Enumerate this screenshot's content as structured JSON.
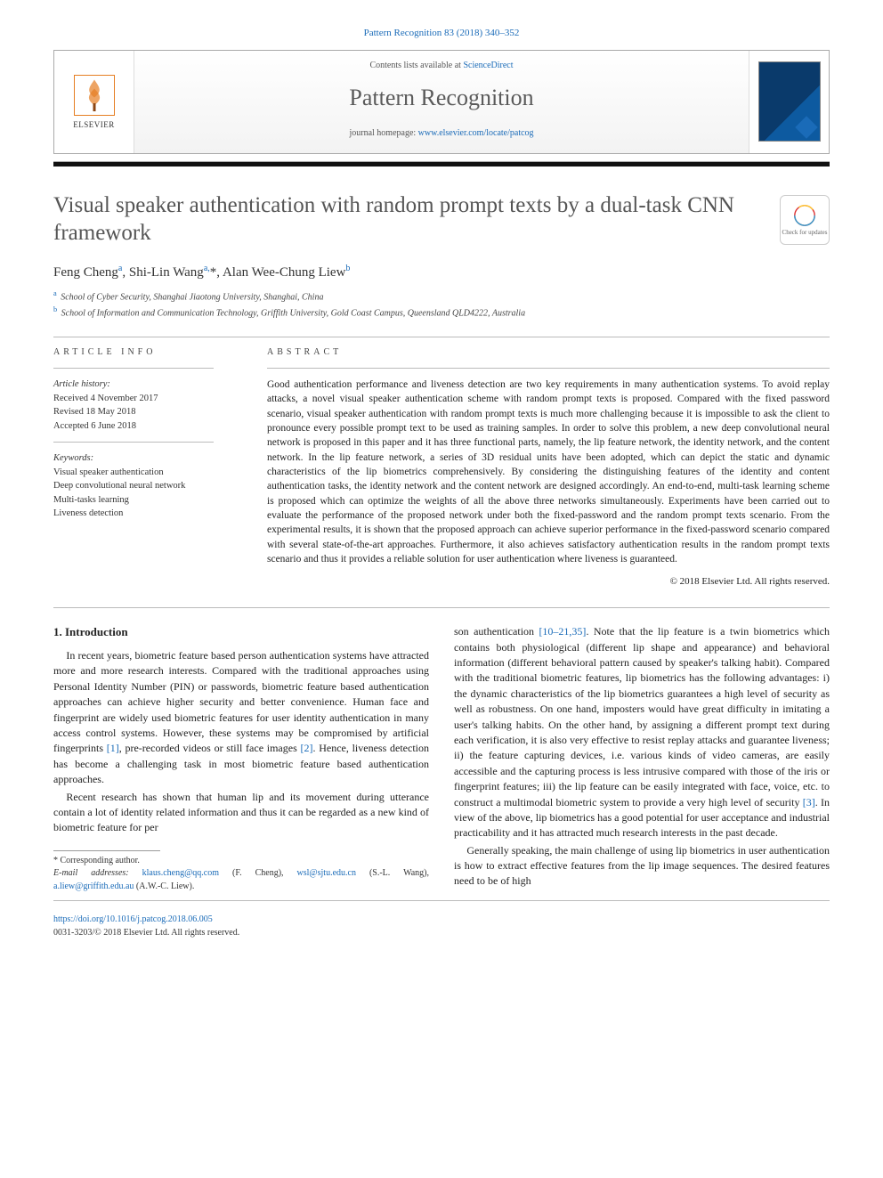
{
  "header": {
    "citation": "Pattern Recognition 83 (2018) 340–352",
    "contents_prefix": "Contents lists available at ",
    "contents_link": "ScienceDirect",
    "journal_name": "Pattern Recognition",
    "homepage_prefix": "journal homepage: ",
    "homepage_link": "www.elsevier.com/locate/patcog",
    "publisher": "ELSEVIER",
    "check_badge": "Check for updates"
  },
  "article": {
    "title": "Visual speaker authentication with random prompt texts by a dual-task CNN framework",
    "authors_html": "Feng Cheng<sup>a</sup>, Shi-Lin Wang<sup>a,</sup><span class='star'>*</span>, Alan Wee-Chung Liew<sup>b</sup>",
    "affiliations": [
      {
        "sup": "a",
        "text": "School of Cyber Security, Shanghai Jiaotong University, Shanghai, China"
      },
      {
        "sup": "b",
        "text": "School of Information and Communication Technology, Griffith University, Gold Coast Campus, Queensland QLD4222, Australia"
      }
    ]
  },
  "info": {
    "section_label": "ARTICLE INFO",
    "history_label": "Article history:",
    "received": "Received 4 November 2017",
    "revised": "Revised 18 May 2018",
    "accepted": "Accepted 6 June 2018",
    "keywords_label": "Keywords:",
    "keywords": [
      "Visual speaker authentication",
      "Deep convolutional neural network",
      "Multi-tasks learning",
      "Liveness detection"
    ]
  },
  "abstract": {
    "section_label": "ABSTRACT",
    "text": "Good authentication performance and liveness detection are two key requirements in many authentication systems. To avoid replay attacks, a novel visual speaker authentication scheme with random prompt texts is proposed. Compared with the fixed password scenario, visual speaker authentication with random prompt texts is much more challenging because it is impossible to ask the client to pronounce every possible prompt text to be used as training samples. In order to solve this problem, a new deep convolutional neural network is proposed in this paper and it has three functional parts, namely, the lip feature network, the identity network, and the content network. In the lip feature network, a series of 3D residual units have been adopted, which can depict the static and dynamic characteristics of the lip biometrics comprehensively. By considering the distinguishing features of the identity and content authentication tasks, the identity network and the content network are designed accordingly. An end-to-end, multi-task learning scheme is proposed which can optimize the weights of all the above three networks simultaneously. Experiments have been carried out to evaluate the performance of the proposed network under both the fixed-password and the random prompt texts scenario. From the experimental results, it is shown that the proposed approach can achieve superior performance in the fixed-password scenario compared with several state-of-the-art approaches. Furthermore, it also achieves satisfactory authentication results in the random prompt texts scenario and thus it provides a reliable solution for user authentication where liveness is guaranteed.",
    "copyright": "© 2018 Elsevier Ltd. All rights reserved."
  },
  "body": {
    "section1_heading": "1. Introduction",
    "p1": "In recent years, biometric feature based person authentication systems have attracted more and more research interests. Compared with the traditional approaches using Personal Identity Number (PIN) or passwords, biometric feature based authentication approaches can achieve higher security and better convenience. Human face and fingerprint are widely used biometric features for user identity authentication in many access control systems. However, these systems may be compromised by artificial fingerprints [1], pre-recorded videos or still face images [2]. Hence, liveness detection has become a challenging task in most biometric feature based authentication approaches.",
    "p2": "Recent research has shown that human lip and its movement during utterance contain a lot of identity related information and thus it can be regarded as a new kind of biometric feature for per",
    "p3": "son authentication [10–21,35]. Note that the lip feature is a twin biometrics which contains both physiological (different lip shape and appearance) and behavioral information (different behavioral pattern caused by speaker's talking habit). Compared with the traditional biometric features, lip biometrics has the following advantages: i) the dynamic characteristics of the lip biometrics guarantees a high level of security as well as robustness. On one hand, imposters would have great difficulty in imitating a user's talking habits. On the other hand, by assigning a different prompt text during each verification, it is also very effective to resist replay attacks and guarantee liveness; ii) the feature capturing devices, i.e. various kinds of video cameras, are easily accessible and the capturing process is less intrusive compared with those of the iris or fingerprint features; iii) the lip feature can be easily integrated with face, voice, etc. to construct a multimodal biometric system to provide a very high level of security [3]. In view of the above, lip biometrics has a good potential for user acceptance and industrial practicability and it has attracted much research interests in the past decade.",
    "p4": "Generally speaking, the main challenge of using lip biometrics in user authentication is how to extract effective features from the lip image sequences. The desired features need to be of high"
  },
  "footnotes": {
    "corresponding": "* Corresponding author.",
    "emails_label": "E-mail addresses:",
    "emails": [
      {
        "addr": "klaus.cheng@qq.com",
        "who": "(F. Cheng),"
      },
      {
        "addr": "wsl@sjtu.edu.cn",
        "who": "(S.-L. Wang),"
      },
      {
        "addr": "a.liew@griffith.edu.au",
        "who": "(A.W.-C. Liew)."
      }
    ]
  },
  "footer": {
    "doi": "https://doi.org/10.1016/j.patcog.2018.06.005",
    "issn_line": "0031-3203/© 2018 Elsevier Ltd. All rights reserved."
  }
}
